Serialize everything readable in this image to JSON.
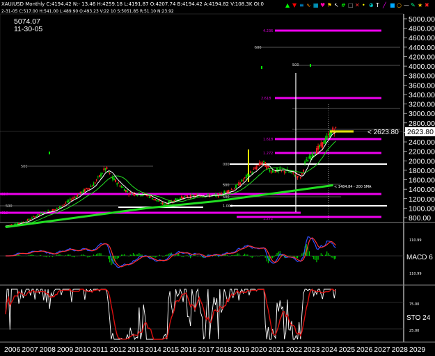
{
  "header": {
    "symbol_line": "XAU/USD  Monthly  C:4194.42  N:- 13.46  H:4259.18  L:4191.87  O:4207.74  B:4194.42  A:4194.82  V:108.3K  OI:0",
    "sub_line": "2-31-05  C:517.00  H:541.00  L:489.90  O:493.23  V:22 10  S:5051.85  R:51.10  N:23.92",
    "cursor_price": "5074.07",
    "cursor_date": "11-30-05"
  },
  "toolbar_icons": [
    "arrow-up-icon",
    "arrow-down-icon",
    "bars-icon",
    "wave-icon",
    "chart-icon",
    "heart-icon",
    "flag-icon",
    "cursor-icon",
    "grid-icon",
    "box-icon",
    "x-icon",
    "pin-icon",
    "zoom-icon",
    "text-icon",
    "line-icon",
    "square-icon",
    "circle-icon",
    "minus-icon",
    "pen-icon",
    "star-icon",
    "close-icon"
  ],
  "colors": {
    "bg": "#000000",
    "bull": "#00dd00",
    "bear": "#ff2020",
    "fib": "#ee00ee",
    "ma_green": "#22dd22",
    "ma_white": "#ffffff",
    "price_tag": "#ffff00",
    "macd_a": "#3050ff",
    "macd_b": "#ff3030",
    "sto_k": "#ffffff",
    "sto_d": "#dd1010"
  },
  "price_labels": [
    "5000.00",
    "4800.00",
    "4600.00",
    "4400.00",
    "4200.00",
    "4000.00",
    "3800.00",
    "3600.00",
    "3400.00",
    "3200.00",
    "3000.00",
    "2800.00",
    "2600.00",
    "2400.00",
    "2200.00",
    "2000.00",
    "1800.00",
    "1600.00",
    "1400.00",
    "1200.00",
    "1000.00",
    "800.00"
  ],
  "last_price_tag": "2623.80",
  "last_price_arrow": "< 2623.80",
  "sma_label": "< 1484.84 - 200 SMA",
  "fib_labels": [
    "4.236",
    "2.618",
    "1.618",
    "1.272",
    "1.272"
  ],
  "ref_labels": [
    "500",
    "500",
    "500",
    "500",
    "500",
    "500",
    "000",
    "1.000",
    "236",
    "618",
    "0.0"
  ],
  "macd_label": "MACD 6",
  "macd_ticks": [
    "110.99",
    "110.99"
  ],
  "sto_label": "STO 24",
  "sto_ticks": [
    "75.00",
    "25.00"
  ],
  "x_labels": [
    "2006",
    "2007",
    "2008",
    "2009",
    "2010",
    "2011",
    "2012",
    "2013",
    "2014",
    "2015",
    "2016",
    "2017",
    "2018",
    "2019",
    "2020",
    "2021",
    "2022",
    "2023",
    "2024",
    "2025",
    "2026",
    "2027",
    "2028",
    "2029"
  ],
  "chart_data": {
    "type": "candlestick",
    "title": "XAU/USD Monthly",
    "price_axis": [
      700,
      5100
    ],
    "x_axis": [
      2006,
      2029
    ],
    "series": [
      {
        "name": "price",
        "x": [
          2006,
          2007,
          2008,
          2009,
          2010,
          2011,
          2011.7,
          2012,
          2013,
          2014,
          2015,
          2016,
          2017,
          2018,
          2019,
          2020.6,
          2021,
          2022,
          2022.8,
          2023,
          2024,
          2024.6
        ],
        "values": [
          620,
          700,
          880,
          1000,
          1250,
          1500,
          1850,
          1650,
          1320,
          1280,
          1080,
          1220,
          1270,
          1260,
          1420,
          1980,
          1800,
          1780,
          1650,
          1950,
          2350,
          2650
        ]
      },
      {
        "name": "200 SMA",
        "x": [
          2006,
          2010,
          2014,
          2018,
          2022,
          2024.6
        ],
        "values": [
          600,
          800,
          1000,
          1150,
          1350,
          1484.84
        ]
      }
    ]
  }
}
